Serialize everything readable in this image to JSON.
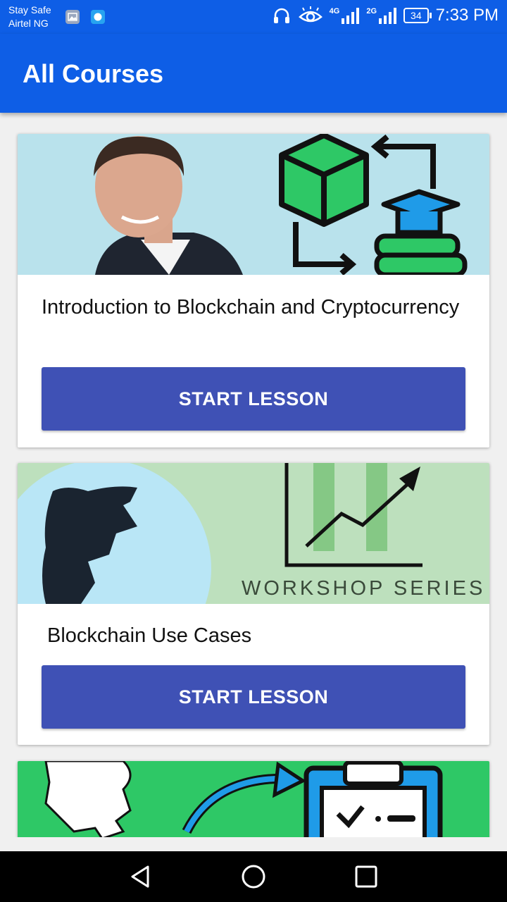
{
  "status_bar": {
    "carrier_line1": "Stay Safe",
    "carrier_line2": "Airtel NG",
    "network_4g": "4G",
    "network_2g": "2G",
    "battery": "34",
    "time": "7:33 PM"
  },
  "app_bar": {
    "title": "All Courses"
  },
  "courses": [
    {
      "title": "Introduction to Blockchain and Cryptocurrency",
      "button_label": "START LESSON"
    },
    {
      "title": "Blockchain Use Cases",
      "banner_text": "WORKSHOP SERIES",
      "button_label": "START LESSON"
    }
  ],
  "nav_bar": {
    "back_icon": "back-triangle-icon",
    "home_icon": "home-circle-icon",
    "recents_icon": "recents-square-icon"
  }
}
